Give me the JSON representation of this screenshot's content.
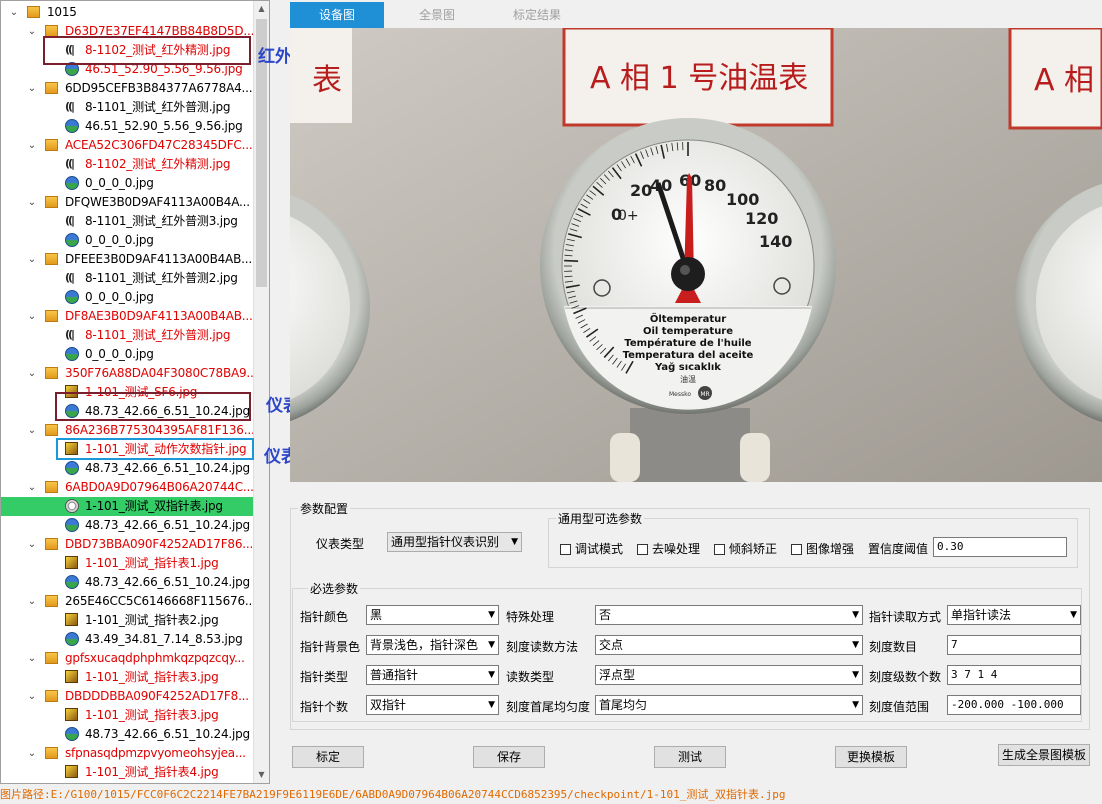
{
  "tree": {
    "rows": [
      {
        "level": 0,
        "expander": "minus",
        "icon": "folder",
        "text": "1015",
        "color": "black"
      },
      {
        "level": 1,
        "expander": "open",
        "icon": "folder",
        "text": "D63D7E37EF4147BB84B8D5D...",
        "color": "red"
      },
      {
        "level": 2,
        "expander": "",
        "icon": "infrared",
        "text": "8-1102_测试_红外精测.jpg",
        "color": "red"
      },
      {
        "level": 2,
        "expander": "",
        "icon": "panorama",
        "text": "46.51_52.90_5.56_9.56.jpg",
        "color": "red"
      },
      {
        "level": 1,
        "expander": "open",
        "icon": "folder",
        "text": "6DD95CEFB3B84377A6778A4...",
        "color": "black"
      },
      {
        "level": 2,
        "expander": "",
        "icon": "infrared",
        "text": "8-1101_测试_红外普测.jpg",
        "color": "black"
      },
      {
        "level": 2,
        "expander": "",
        "icon": "panorama",
        "text": "46.51_52.90_5.56_9.56.jpg",
        "color": "black"
      },
      {
        "level": 1,
        "expander": "open",
        "icon": "folder",
        "text": "ACEA52C306FD47C28345DFC...",
        "color": "red"
      },
      {
        "level": 2,
        "expander": "",
        "icon": "infrared",
        "text": "8-1102_测试_红外精测.jpg",
        "color": "red"
      },
      {
        "level": 2,
        "expander": "",
        "icon": "panorama",
        "text": "0_0_0_0.jpg",
        "color": "black"
      },
      {
        "level": 1,
        "expander": "open",
        "icon": "folder",
        "text": "DFQWE3B0D9AF4113A00B4A...",
        "color": "black"
      },
      {
        "level": 2,
        "expander": "",
        "icon": "infrared",
        "text": "8-1101_测试_红外普测3.jpg",
        "color": "black"
      },
      {
        "level": 2,
        "expander": "",
        "icon": "panorama",
        "text": "0_0_0_0.jpg",
        "color": "black"
      },
      {
        "level": 1,
        "expander": "open",
        "icon": "folder",
        "text": "DFEEE3B0D9AF4113A00B4AB...",
        "color": "black"
      },
      {
        "level": 2,
        "expander": "",
        "icon": "infrared",
        "text": "8-1101_测试_红外普测2.jpg",
        "color": "black"
      },
      {
        "level": 2,
        "expander": "",
        "icon": "panorama",
        "text": "0_0_0_0.jpg",
        "color": "black"
      },
      {
        "level": 1,
        "expander": "open",
        "icon": "folder",
        "text": "DF8AE3B0D9AF4113A00B4AB...",
        "color": "red"
      },
      {
        "level": 2,
        "expander": "",
        "icon": "infrared",
        "text": "8-1101_测试_红外普测.jpg",
        "color": "red"
      },
      {
        "level": 2,
        "expander": "",
        "icon": "panorama",
        "text": "0_0_0_0.jpg",
        "color": "black"
      },
      {
        "level": 1,
        "expander": "open",
        "icon": "folder",
        "text": "350F76A88DA04F3080C78BA9...",
        "color": "red"
      },
      {
        "level": 2,
        "expander": "",
        "icon": "device",
        "text": "1-101_测试_SF6.jpg",
        "color": "red"
      },
      {
        "level": 2,
        "expander": "",
        "icon": "panorama",
        "text": "48.73_42.66_6.51_10.24.jpg",
        "color": "black"
      },
      {
        "level": 1,
        "expander": "open",
        "icon": "folder",
        "text": "86A236B775304395AF81F136...",
        "color": "red"
      },
      {
        "level": 2,
        "expander": "",
        "icon": "device",
        "text": "1-101_测试_动作次数指针.jpg",
        "color": "red"
      },
      {
        "level": 2,
        "expander": "",
        "icon": "panorama",
        "text": "48.73_42.66_6.51_10.24.jpg",
        "color": "black"
      },
      {
        "level": 1,
        "expander": "open",
        "icon": "folder",
        "text": "6ABD0A9D07964B06A20744C...",
        "color": "red"
      },
      {
        "level": 2,
        "expander": "",
        "icon": "gauge",
        "text": "1-101_测试_双指针表.jpg",
        "color": "black",
        "selected": true
      },
      {
        "level": 2,
        "expander": "",
        "icon": "panorama",
        "text": "48.73_42.66_6.51_10.24.jpg",
        "color": "black"
      },
      {
        "level": 1,
        "expander": "open",
        "icon": "folder",
        "text": "DBD73BBA090F4252AD17F86...",
        "color": "red"
      },
      {
        "level": 2,
        "expander": "",
        "icon": "device",
        "text": "1-101_测试_指针表1.jpg",
        "color": "red"
      },
      {
        "level": 2,
        "expander": "",
        "icon": "panorama",
        "text": "48.73_42.66_6.51_10.24.jpg",
        "color": "black"
      },
      {
        "level": 1,
        "expander": "open",
        "icon": "folder",
        "text": "265E46CC5C6146668F115676...",
        "color": "black"
      },
      {
        "level": 2,
        "expander": "",
        "icon": "device",
        "text": "1-101_测试_指针表2.jpg",
        "color": "black"
      },
      {
        "level": 2,
        "expander": "",
        "icon": "panorama",
        "text": "43.49_34.81_7.14_8.53.jpg",
        "color": "black"
      },
      {
        "level": 1,
        "expander": "open",
        "icon": "folder",
        "text": "gpfsxucaqdphphmkqzpqzcqy...",
        "color": "red"
      },
      {
        "level": 2,
        "expander": "",
        "icon": "device",
        "text": "1-101_测试_指针表3.jpg",
        "color": "red"
      },
      {
        "level": 1,
        "expander": "open",
        "icon": "folder",
        "text": "DBDDDBBA090F4252AD17F8...",
        "color": "red"
      },
      {
        "level": 2,
        "expander": "",
        "icon": "device",
        "text": "1-101_测试_指针表3.jpg",
        "color": "red"
      },
      {
        "level": 2,
        "expander": "",
        "icon": "panorama",
        "text": "48.73_42.66_6.51_10.24.jpg",
        "color": "black"
      },
      {
        "level": 1,
        "expander": "open",
        "icon": "folder",
        "text": "sfpnasqdpmzpvyomeohsyjea...",
        "color": "red"
      },
      {
        "level": 2,
        "expander": "",
        "icon": "device",
        "text": "1-101_测试_指针表4.jpg",
        "color": "red"
      }
    ]
  },
  "annotations": {
    "infrared_device_image": "红外设备图",
    "meter_panorama_image": "仪表全景图",
    "meter_device_image": "仪表设备图"
  },
  "tabs": [
    {
      "label": "设备图",
      "active": true
    },
    {
      "label": "全景图",
      "active": false
    },
    {
      "label": "标定结果",
      "active": false
    }
  ],
  "photo": {
    "sign_left": "表",
    "sign_center": "A 相 1 号油温表",
    "sign_right": "A 相",
    "dial_numbers": [
      "0",
      "20",
      "40",
      "60",
      "80",
      "100",
      "120",
      "140"
    ],
    "dial_sign_small": "0+",
    "dial_label_1": "Öltemperatur",
    "dial_label_2": "Oil temperature",
    "dial_label_3": "Température de l'huile",
    "dial_label_4": "Temperatura del aceite",
    "dial_label_5": "Yağ sıcaklık",
    "dial_label_6": "油温",
    "dial_brand": "Messko",
    "dial_logo": "MR"
  },
  "params": {
    "group_title": "参数配置",
    "meter_type_label": "仪表类型",
    "meter_type_value": "通用型指针仪表识别",
    "optional_group_title": "通用型可选参数",
    "checkboxes": [
      "调试模式",
      "去噪处理",
      "倾斜矫正",
      "图像增强"
    ],
    "confidence_label": "置信度阈值",
    "confidence_value": "0.30",
    "required_group_title": "必选参数",
    "pointer_color_label": "指针颜色",
    "pointer_color_value": "黑",
    "special_label": "特殊处理",
    "special_value": "否",
    "read_mode_label": "指针读取方式",
    "read_mode_value": "单指针读法",
    "bg_color_label": "指针背景色",
    "bg_color_value": "背景浅色，指针深色",
    "scale_method_label": "刻度读数方法",
    "scale_method_value": "交点",
    "scale_count_label": "刻度数目",
    "scale_count_value": "7",
    "pointer_type_label": "指针类型",
    "pointer_type_value": "普通指针",
    "reading_type_label": "读数类型",
    "reading_type_value": "浮点型",
    "scale_levels_label": "刻度级数个数",
    "scale_levels_value": "3 7 1 4",
    "pointer_count_label": "指针个数",
    "pointer_count_value": "双指针",
    "uniform_label": "刻度首尾均匀度",
    "uniform_value": "首尾均匀",
    "range_label": "刻度值范围",
    "range_value": "-200.000 -100.000"
  },
  "buttons": {
    "calibrate": "标定",
    "save": "保存",
    "test": "测试",
    "replace_template": "更换模板",
    "gen_template": "生成全景图模板"
  },
  "status": {
    "path": "图片路径:E:/G100/1015/FCC0F6C2C2214FE7BA219F9E6119E6DE/6ABD0A9D07964B06A20744CCD6852395/checkpoint/1-101_测试_双指针表.jpg"
  },
  "colors": {
    "tab_active": "#1f8fd6",
    "selected_row": "#33cc66",
    "red_text": "#e00000",
    "annotation_text": "#2b46c8",
    "status_text": "#e06a00"
  }
}
